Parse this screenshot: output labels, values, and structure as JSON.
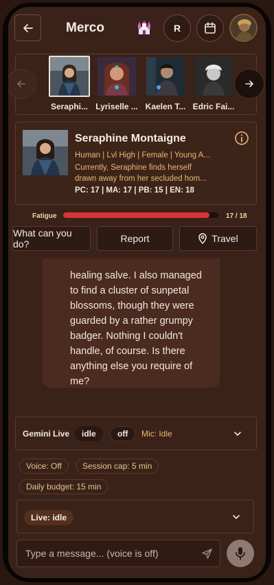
{
  "header": {
    "title": "Merco",
    "r_label": "R"
  },
  "carousel": {
    "characters": [
      {
        "name": "Seraphi...",
        "selected": true
      },
      {
        "name": "Lyriselle ...",
        "selected": false
      },
      {
        "name": "Kaelen T...",
        "selected": false
      },
      {
        "name": "Edric Fai...",
        "selected": false
      }
    ]
  },
  "profile": {
    "name": "Seraphine Montaigne",
    "tags": "Human | Lvl High | Female | Young A...",
    "desc_line1": "Currently, Seraphine finds herself",
    "desc_line2": "drawn away from her secluded hom...",
    "stats": "PC: 17 | MA: 17 | PB: 15 | EN: 18"
  },
  "fatigue": {
    "label": "Fatigue",
    "value_text": "17 / 18",
    "fraction": 0.944
  },
  "actions": {
    "what_label": "What can you do?",
    "report_label": "Report",
    "travel_label": "Travel"
  },
  "message": {
    "lines": [
      "healing salve. I also managed",
      "to find a cluster of sunpetal",
      "blossoms, though they were",
      "guarded by a rather grumpy",
      "badger. Nothing I couldn't",
      "handle, of course. Is there",
      "anything else you require of",
      "me?"
    ]
  },
  "gemini": {
    "label": "Gemini Live",
    "state": "idle",
    "toggle": "off",
    "mic": "Mic: Idle"
  },
  "chips": {
    "voice": "Voice: Off",
    "session_cap": "Session cap: 5 min",
    "daily_budget": "Daily budget: 15 min"
  },
  "live": {
    "status": "Live: idle"
  },
  "composer": {
    "placeholder": "Type a message... (voice is off)"
  },
  "colors": {
    "background": "#3a2219",
    "accent_text": "#e7b974",
    "fatigue_fill": "#d8333a"
  }
}
